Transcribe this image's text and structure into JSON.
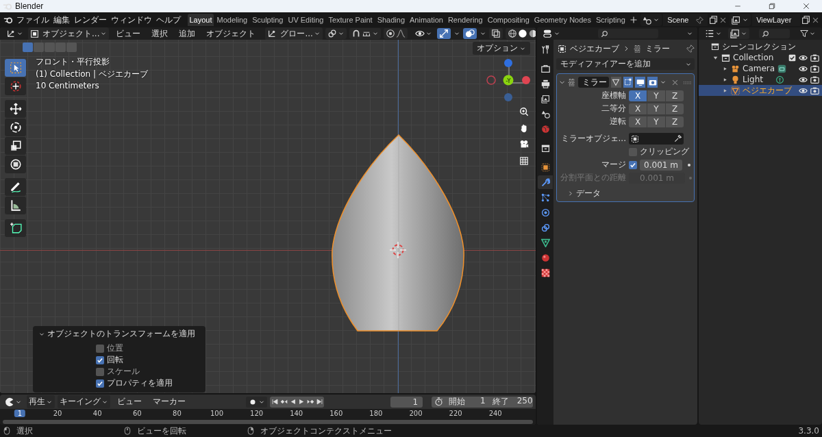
{
  "window": {
    "title": "Blender"
  },
  "menu": [
    "ファイル",
    "編集",
    "レンダー",
    "ウィンドウ",
    "ヘルプ"
  ],
  "workspaces": [
    {
      "label": "Layout",
      "selected": true
    },
    {
      "label": "Modeling",
      "selected": false
    },
    {
      "label": "Sculpting",
      "selected": false
    },
    {
      "label": "UV Editing",
      "selected": false
    },
    {
      "label": "Texture Paint",
      "selected": false
    },
    {
      "label": "Shading",
      "selected": false
    },
    {
      "label": "Animation",
      "selected": false
    },
    {
      "label": "Rendering",
      "selected": false
    },
    {
      "label": "Compositing",
      "selected": false
    },
    {
      "label": "Geometry Nodes",
      "selected": false
    },
    {
      "label": "Scripting",
      "selected": false
    }
  ],
  "scene": "Scene",
  "view_layer": "ViewLayer",
  "viewport": {
    "mode": "オブジェクト...",
    "menus": [
      "ビュー",
      "選択",
      "追加",
      "オブジェクト"
    ],
    "orientation": "グロー...",
    "options": "オプション",
    "overlay_text": [
      "フロント・平行投影",
      "(1) Collection | ベジエカーブ",
      "10 Centimeters"
    ],
    "gizmo_label": "-Y",
    "tools": [
      {
        "kind": "select",
        "selected": true
      },
      {
        "kind": "cursor",
        "selected": false
      },
      {
        "kind": "move",
        "selected": false
      },
      {
        "kind": "rotate",
        "selected": false
      },
      {
        "kind": "scale",
        "selected": false
      },
      {
        "kind": "transform",
        "selected": false
      },
      {
        "kind": "annotate",
        "selected": false
      },
      {
        "kind": "measure",
        "selected": false
      },
      {
        "kind": "add_cube",
        "selected": false
      }
    ],
    "operator_panel": {
      "title": "オブジェクトのトランスフォームを適用",
      "options": [
        {
          "label": "位置",
          "checked": false
        },
        {
          "label": "回転",
          "checked": true
        },
        {
          "label": "スケール",
          "checked": false
        },
        {
          "label": "プロパティを適用",
          "checked": true
        }
      ]
    }
  },
  "properties": {
    "tabs": [
      {
        "kind": "tool",
        "selected": false
      },
      {
        "kind": "render",
        "selected": false
      },
      {
        "kind": "output",
        "selected": false
      },
      {
        "kind": "view_layer",
        "selected": false
      },
      {
        "kind": "scene",
        "selected": false
      },
      {
        "kind": "world",
        "selected": false
      },
      {
        "kind": "collection",
        "selected": false
      },
      {
        "kind": "object",
        "selected": false
      },
      {
        "kind": "modifiers",
        "selected": true
      },
      {
        "kind": "particles",
        "selected": false
      },
      {
        "kind": "physics",
        "selected": false
      },
      {
        "kind": "constraints",
        "selected": false
      },
      {
        "kind": "data",
        "selected": false
      },
      {
        "kind": "material",
        "selected": false
      },
      {
        "kind": "texture",
        "selected": false
      }
    ],
    "breadcrumb": [
      "ベジエカーブ",
      "ミラー"
    ],
    "add_modifier": "モディファイアーを追加",
    "modifier": {
      "name": "ミラー",
      "expanded": true,
      "axis_rows": [
        {
          "label": "座標軸",
          "buttons": [
            {
              "label": "X",
              "selected": true
            },
            {
              "label": "Y",
              "selected": false
            },
            {
              "label": "Z",
              "selected": false
            }
          ]
        },
        {
          "label": "二等分",
          "buttons": [
            {
              "label": "X",
              "selected": false
            },
            {
              "label": "Y",
              "selected": false
            },
            {
              "label": "Z",
              "selected": false
            }
          ]
        },
        {
          "label": "逆転",
          "buttons": [
            {
              "label": "X",
              "selected": false
            },
            {
              "label": "Y",
              "selected": false
            },
            {
              "label": "Z",
              "selected": false
            }
          ]
        }
      ],
      "mirror_object_label": "ミラーオブジェ...",
      "clipping": {
        "label": "クリッピング",
        "checked": false
      },
      "merge": {
        "label": "マージ",
        "checked": true,
        "value": "0.001 m"
      },
      "bisect_distance": {
        "label": "分割平面との距離",
        "value": "0.001 m",
        "disabled": true
      },
      "data_section": "データ"
    }
  },
  "outliner": {
    "root": "シーンコレクション",
    "items": [
      {
        "label": "Collection",
        "kind": "collection",
        "expanded": true,
        "selected": false,
        "children": [
          {
            "label": "Camera",
            "kind": "camera",
            "selected": false
          },
          {
            "label": "Light",
            "kind": "light",
            "selected": false
          },
          {
            "label": "ベジエカーブ",
            "kind": "curve",
            "selected": true
          }
        ]
      }
    ]
  },
  "timeline": {
    "menus": [
      "再生",
      "キーイング",
      "ビュー",
      "マーカー"
    ],
    "current_frame": "1",
    "start_label": "開始",
    "start": "1",
    "end_label": "終了",
    "end": "250",
    "ruler": [
      "1",
      "20",
      "40",
      "60",
      "80",
      "100",
      "120",
      "140",
      "160",
      "180",
      "200",
      "220",
      "240"
    ]
  },
  "status_bar": {
    "hints": [
      "選択",
      "ビューを回転",
      "オブジェクトコンテクストメニュー"
    ],
    "version": "3.3.0"
  }
}
